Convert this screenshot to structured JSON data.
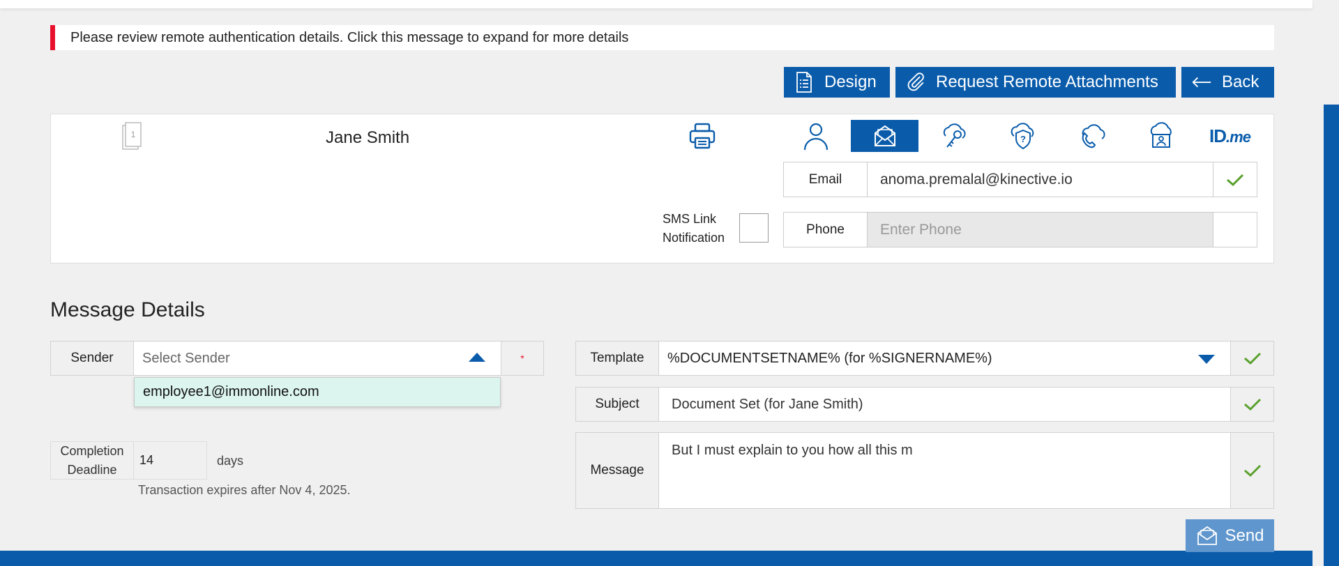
{
  "alert": {
    "message": "Please review remote authentication details. Click this message to expand for more details"
  },
  "toolbar": {
    "design_label": "Design",
    "request_attachments_label": "Request Remote Attachments",
    "back_label": "Back"
  },
  "recipient": {
    "doc_number": "1",
    "name": "Jane Smith",
    "auth_tabs": [
      {
        "icon": "person-icon",
        "active": false
      },
      {
        "icon": "envelope-icon",
        "active": true
      },
      {
        "icon": "key-cloud-icon",
        "active": false
      },
      {
        "icon": "shield-question-icon",
        "active": false
      },
      {
        "icon": "phone-cloud-icon",
        "active": false
      },
      {
        "icon": "id-cloud-icon",
        "active": false
      },
      {
        "icon": "idme-logo",
        "active": false,
        "text_main": "ID",
        "text_suffix": ".me"
      }
    ],
    "email_label": "Email",
    "email_value": "anoma.premalal@kinective.io",
    "sms_label_line1": "SMS Link",
    "sms_label_line2": "Notification",
    "phone_label": "Phone",
    "phone_placeholder": "Enter Phone"
  },
  "message_details": {
    "title": "Message Details",
    "sender_label": "Sender",
    "sender_placeholder": "Select Sender",
    "required_marker": "*",
    "sender_options": [
      "employee1@immonline.com"
    ],
    "deadline_label_line1": "Completion",
    "deadline_label_line2": "Deadline",
    "deadline_value": "14",
    "days_label": "days",
    "expires_text": "Transaction expires after Nov 4, 2025.",
    "template_label": "Template",
    "template_value": "%DOCUMENTSETNAME% (for %SIGNERNAME%)",
    "subject_label": "Subject",
    "subject_value": "Document Set (for Jane Smith)",
    "message_label": "Message",
    "message_value": "But I must explain to you how all this m",
    "send_label": "Send"
  },
  "colors": {
    "primary": "#0a5cab",
    "alert_accent": "#e8112d",
    "check_green": "#5aa02c",
    "dropdown_highlight": "#dcf5ee",
    "send_disabled": "#5f96cd"
  }
}
